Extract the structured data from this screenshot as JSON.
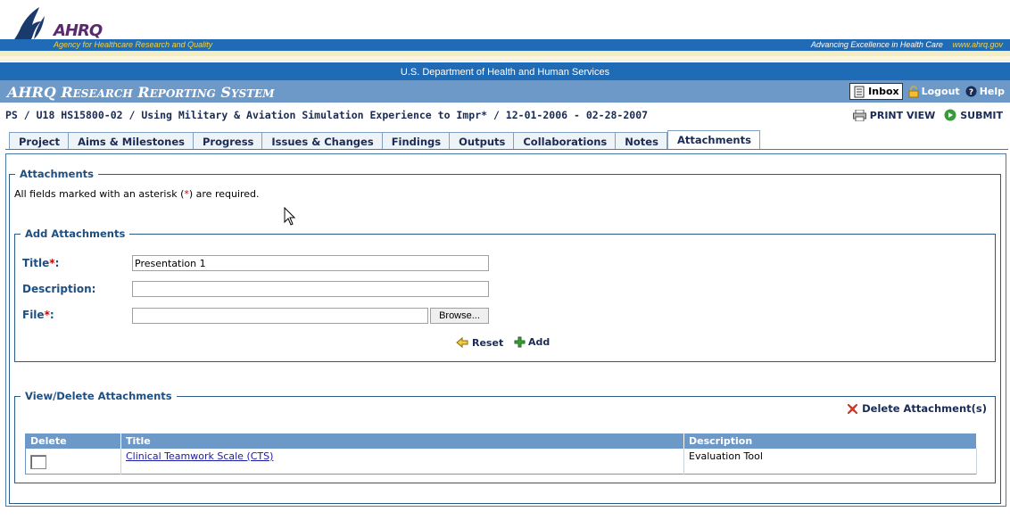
{
  "header": {
    "logo_text": "AHRQ",
    "tagline": "Agency for Healthcare Research and Quality",
    "right_slogan": "Advancing Excellence in Health Care",
    "right_url": "www.ahrq.gov",
    "department": "U.S. Department of Health and Human Services"
  },
  "system": {
    "name_prefix": "AHRQ R",
    "name_research": "ESEARCH",
    "name_r2": " R",
    "name_reporting": "EPORTING",
    "name_s": " S",
    "name_system": "YSTEM",
    "nav": {
      "inbox": "Inbox",
      "logout": "Logout",
      "help": "Help"
    }
  },
  "breadcrumb": "PS / U18 HS15800-02 / Using Military & Aviation Simulation Experience to Impr* / 12-01-2006 - 02-28-2007",
  "actions": {
    "print": "PRINT VIEW",
    "submit": "SUBMIT"
  },
  "tabs": [
    {
      "label": "Project"
    },
    {
      "label": "Aims & Milestones"
    },
    {
      "label": "Progress"
    },
    {
      "label": "Issues & Changes"
    },
    {
      "label": "Findings"
    },
    {
      "label": "Outputs"
    },
    {
      "label": "Collaborations"
    },
    {
      "label": "Notes"
    },
    {
      "label": "Attachments",
      "active": true
    }
  ],
  "attachments": {
    "legend": "Attachments",
    "required_prefix": "All fields marked with an asterisk (",
    "required_ast": "*",
    "required_suffix": ") are required."
  },
  "add": {
    "legend": "Add Attachments",
    "title_label": "Title",
    "title_value": "Presentation 1",
    "description_label": "Description",
    "description_value": "",
    "file_label": "File",
    "file_value": "",
    "browse_label": "Browse...",
    "reset_label": "Reset",
    "add_label": "Add",
    "asterisk": "*",
    "colon": ":"
  },
  "view": {
    "legend": "View/Delete Attachments",
    "delete_label": "Delete Attachment(s)",
    "columns": {
      "delete": "Delete",
      "title": "Title",
      "description": "Description"
    },
    "rows": [
      {
        "title": "Clinical Teamwork Scale (CTS)",
        "description": "Evaluation Tool"
      }
    ]
  },
  "colors": {
    "brand_blue": "#1f6bb5",
    "system_bar": "#6d99c9",
    "label_blue": "#1f4f80",
    "required_red": "#cc0000"
  },
  "icons": {
    "logo": "hhs-eagle-icon",
    "inbox": "inbox-icon",
    "logout": "padlock-icon",
    "help": "help-icon",
    "print": "printer-icon",
    "submit": "play-icon",
    "reset": "reset-arrow-icon",
    "add": "plus-icon",
    "delete": "red-x-icon"
  }
}
